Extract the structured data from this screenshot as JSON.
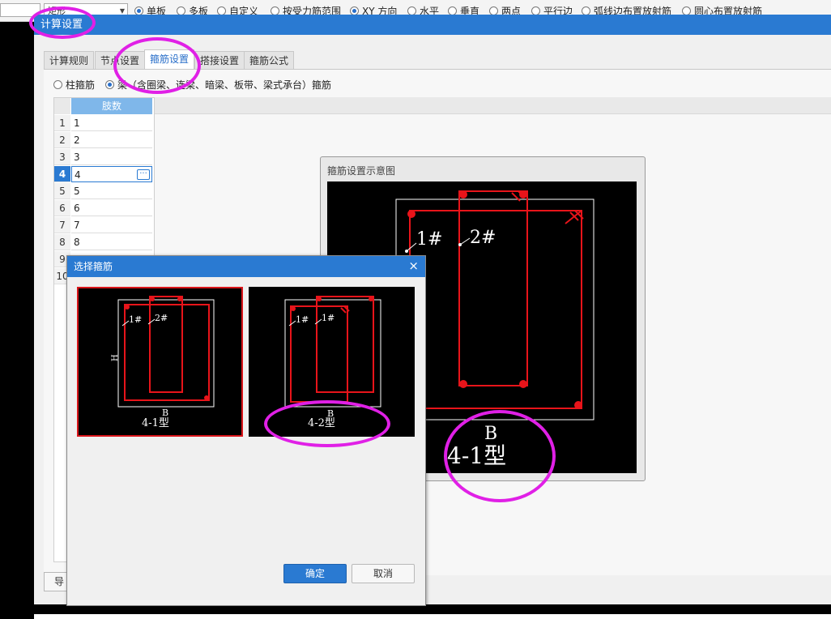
{
  "toolbar": {
    "combo_value": "矩形",
    "radios": [
      {
        "label": "单板",
        "checked": true
      },
      {
        "label": "多板",
        "checked": false
      },
      {
        "label": "自定义",
        "checked": false
      },
      {
        "label": "按受力筋范围",
        "checked": false
      },
      {
        "label": "XY 方向",
        "checked": true
      },
      {
        "label": "水平",
        "checked": false
      },
      {
        "label": "垂直",
        "checked": false
      },
      {
        "label": "两点",
        "checked": false
      },
      {
        "label": "平行边",
        "checked": false
      },
      {
        "label": "弧线边布置放射筋",
        "checked": false
      },
      {
        "label": "圆心布置放射筋",
        "checked": false
      }
    ]
  },
  "main_dialog": {
    "title": "计算设置",
    "tabs": [
      {
        "label": "计算规则",
        "active": false
      },
      {
        "label": "节点设置",
        "active": false
      },
      {
        "label": "箍筋设置",
        "active": true
      },
      {
        "label": "搭接设置",
        "active": false
      },
      {
        "label": "箍筋公式",
        "active": false
      }
    ],
    "radio_column": "柱箍筋",
    "radio_beam": "梁（含圈梁、连梁、暗梁、板带、梁式承台）箍筋",
    "export_label": "导"
  },
  "grid": {
    "header": "肢数",
    "rows": [
      {
        "num": "1",
        "value": "1"
      },
      {
        "num": "2",
        "value": "2"
      },
      {
        "num": "3",
        "value": "3"
      },
      {
        "num": "4",
        "value": "4"
      },
      {
        "num": "5",
        "value": "5"
      },
      {
        "num": "6",
        "value": "6"
      },
      {
        "num": "7",
        "value": "7"
      },
      {
        "num": "8",
        "value": "8"
      },
      {
        "num": "9",
        "value": ""
      },
      {
        "num": "10",
        "value": ""
      }
    ],
    "selected_row": "4"
  },
  "preview": {
    "title": "箍筋设置示意图",
    "label_1": "1#",
    "label_2": "2#",
    "label_b": "B",
    "type_label": "4-1型"
  },
  "select_dialog": {
    "title": "选择箍筋",
    "close": "×",
    "options": [
      {
        "label": "4-1型",
        "tag1": "1#",
        "tag2": "2#",
        "b": "B",
        "h": "H",
        "selected": true
      },
      {
        "label": "4-2型",
        "tag1": "1#",
        "tag2": "1#",
        "b": "B",
        "selected": false
      }
    ],
    "ok": "确定",
    "cancel": "取消"
  },
  "colors": {
    "title_blue": "#2a7ad2",
    "rebar_red": "#e8141a",
    "highlight": "#e020e6"
  }
}
